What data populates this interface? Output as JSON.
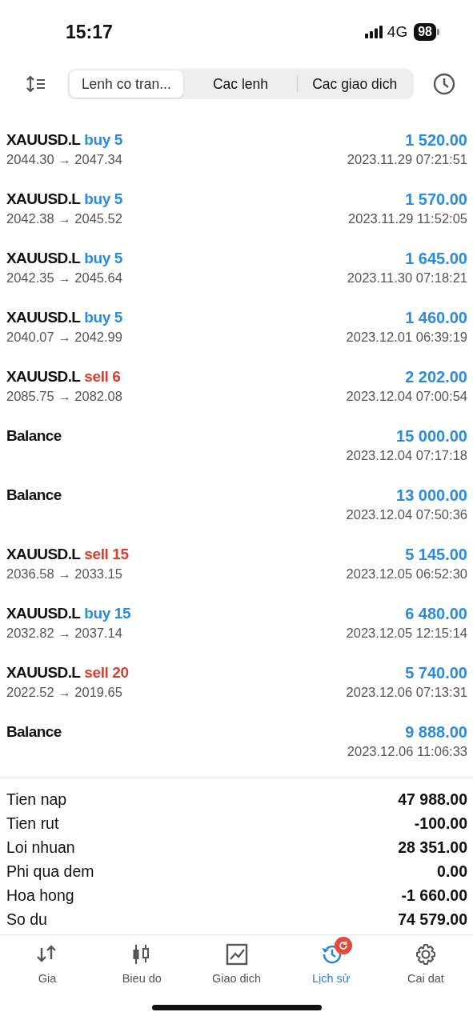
{
  "status_bar": {
    "time": "15:17",
    "network": "4G",
    "battery": "98"
  },
  "tabs": [
    {
      "label": "Lenh co tran...",
      "selected": true
    },
    {
      "label": "Cac lenh",
      "selected": false
    },
    {
      "label": "Cac giao dich",
      "selected": false
    }
  ],
  "entries": [
    {
      "kind": "trade",
      "symbol": "XAUUSD.L",
      "order": "buy 5",
      "color": "#2b8be0",
      "prices": "2044.30 → 2047.34",
      "amount": "1 520.00",
      "time": "2023.11.29 07:21:51"
    },
    {
      "kind": "trade",
      "symbol": "XAUUSD.L",
      "order": "buy 5",
      "color": "#2b8be0",
      "prices": "2042.38 → 2045.52",
      "amount": "1 570.00",
      "time": "2023.11.29 11:52:05"
    },
    {
      "kind": "trade",
      "symbol": "XAUUSD.L",
      "order": "buy 5",
      "color": "#2b8be0",
      "prices": "2042.35 → 2045.64",
      "amount": "1 645.00",
      "time": "2023.11.30 07:18:21"
    },
    {
      "kind": "trade",
      "symbol": "XAUUSD.L",
      "order": "buy 5",
      "color": "#2b8be0",
      "prices": "2040.07 → 2042.99",
      "amount": "1 460.00",
      "time": "2023.12.01 06:39:19"
    },
    {
      "kind": "trade",
      "symbol": "XAUUSD.L",
      "order": "sell 6",
      "color": "#d8402e",
      "prices": "2085.75 → 2082.08",
      "amount": "2 202.00",
      "time": "2023.12.04 07:00:54"
    },
    {
      "kind": "balance",
      "label": "Balance",
      "amount": "15 000.00",
      "time": "2023.12.04 07:17:18"
    },
    {
      "kind": "balance",
      "label": "Balance",
      "amount": "13 000.00",
      "time": "2023.12.04 07:50:36"
    },
    {
      "kind": "trade",
      "symbol": "XAUUSD.L",
      "order": "sell 15",
      "color": "#d8402e",
      "prices": "2036.58 → 2033.15",
      "amount": "5 145.00",
      "time": "2023.12.05 06:52:30"
    },
    {
      "kind": "trade",
      "symbol": "XAUUSD.L",
      "order": "buy 15",
      "color": "#2b8be0",
      "prices": "2032.82 → 2037.14",
      "amount": "6 480.00",
      "time": "2023.12.05 12:15:14"
    },
    {
      "kind": "trade",
      "symbol": "XAUUSD.L",
      "order": "sell 20",
      "color": "#d8402e",
      "prices": "2022.52 → 2019.65",
      "amount": "5 740.00",
      "time": "2023.12.06 07:13:31"
    },
    {
      "kind": "balance",
      "label": "Balance",
      "amount": "9 888.00",
      "time": "2023.12.06 11:06:33"
    }
  ],
  "summary": [
    {
      "label": "Tien nap",
      "value": "47 988.00"
    },
    {
      "label": "Tien rut",
      "value": "-100.00"
    },
    {
      "label": "Loi nhuan",
      "value": "28 351.00"
    },
    {
      "label": "Phi qua dem",
      "value": "0.00"
    },
    {
      "label": "Hoa hong",
      "value": "-1 660.00"
    },
    {
      "label": "So du",
      "value": "74 579.00"
    }
  ],
  "bottom_nav": [
    {
      "label": "Gia",
      "kind": "arrows",
      "selected": false
    },
    {
      "label": "Bieu do",
      "kind": "candles",
      "selected": false
    },
    {
      "label": "Giao dich",
      "kind": "chart",
      "selected": false
    },
    {
      "label": "Lịch sử",
      "kind": "history",
      "selected": true,
      "badge": true
    },
    {
      "label": "Cai dat",
      "kind": "gear",
      "selected": false
    }
  ]
}
